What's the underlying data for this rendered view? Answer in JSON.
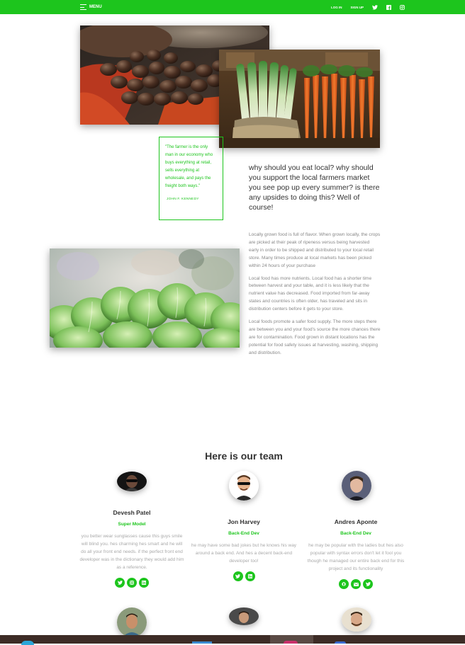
{
  "nav": {
    "menu_label": "MENU",
    "login_label": "LOG IN",
    "signup_label": "SIGN UP",
    "icons": [
      "twitter-icon",
      "facebook-icon",
      "instagram-icon"
    ]
  },
  "quote": {
    "text": "\"The farmer is the only man in our economy who buys everything at retail, sells everything at wholesale, and pays the freight both ways.\"",
    "author": "JOHN F. KENNEDY"
  },
  "article": {
    "heading": "why should you eat local? why should you support the local farmers market you see pop up every summer? is there any upsides to doing this? Well of course!",
    "paragraphs": [
      "Locally grown food is full of flavor. When grown locally, the crops are picked at their peak of ripeness versus being harvested early in order to be shipped and distributed to your local retail store. Many times produce at local markets has been picked within 24 hours of your purchase",
      "Local food has more nutrients. Local food has a shorter time between harvest and your table, and it is less likely that the nutrient value has decreased. Food imported from far-away states and countries is often older, has traveled and sits in distribution centers before it gets to your store.",
      "Local foods promote a safer food supply. The more steps there are between you and your food's source the more chances there are for contamination. Food grown in distant locations has the potential for food safety issues at harvesting, washing, shipping and distribution."
    ]
  },
  "team": {
    "title": "Here is our team",
    "members": [
      {
        "name": "Devesh Patel",
        "role": "Super Model",
        "desc": "you better wear sunglasses cause this guys smile will blind you. hes charming hes smart and he will do all your front end needs. if the perfect front end developer was in the dictionary they would add him as a reference.",
        "socials": [
          "twitter-icon",
          "instagram-icon",
          "linkedin-icon"
        ]
      },
      {
        "name": "Jon Harvey",
        "role": "Back-End Dev",
        "desc": "he may have some bad jokes but he knows his way around a back end. And hes a decent back-end developer too!",
        "socials": [
          "twitter-icon",
          "linkedin-icon"
        ]
      },
      {
        "name": "Andres Aponte",
        "role": "Back-End Dev",
        "desc": "he may be popular with the ladies but hes also popular with syntax errors don't let it fool you though he managed our entire back end for this project and its functionality",
        "socials": [
          "github-icon",
          "mail-icon",
          "twitter-icon"
        ]
      }
    ]
  },
  "colors": {
    "accent": "#1dc51d",
    "taskbar": "#3d2c26"
  }
}
